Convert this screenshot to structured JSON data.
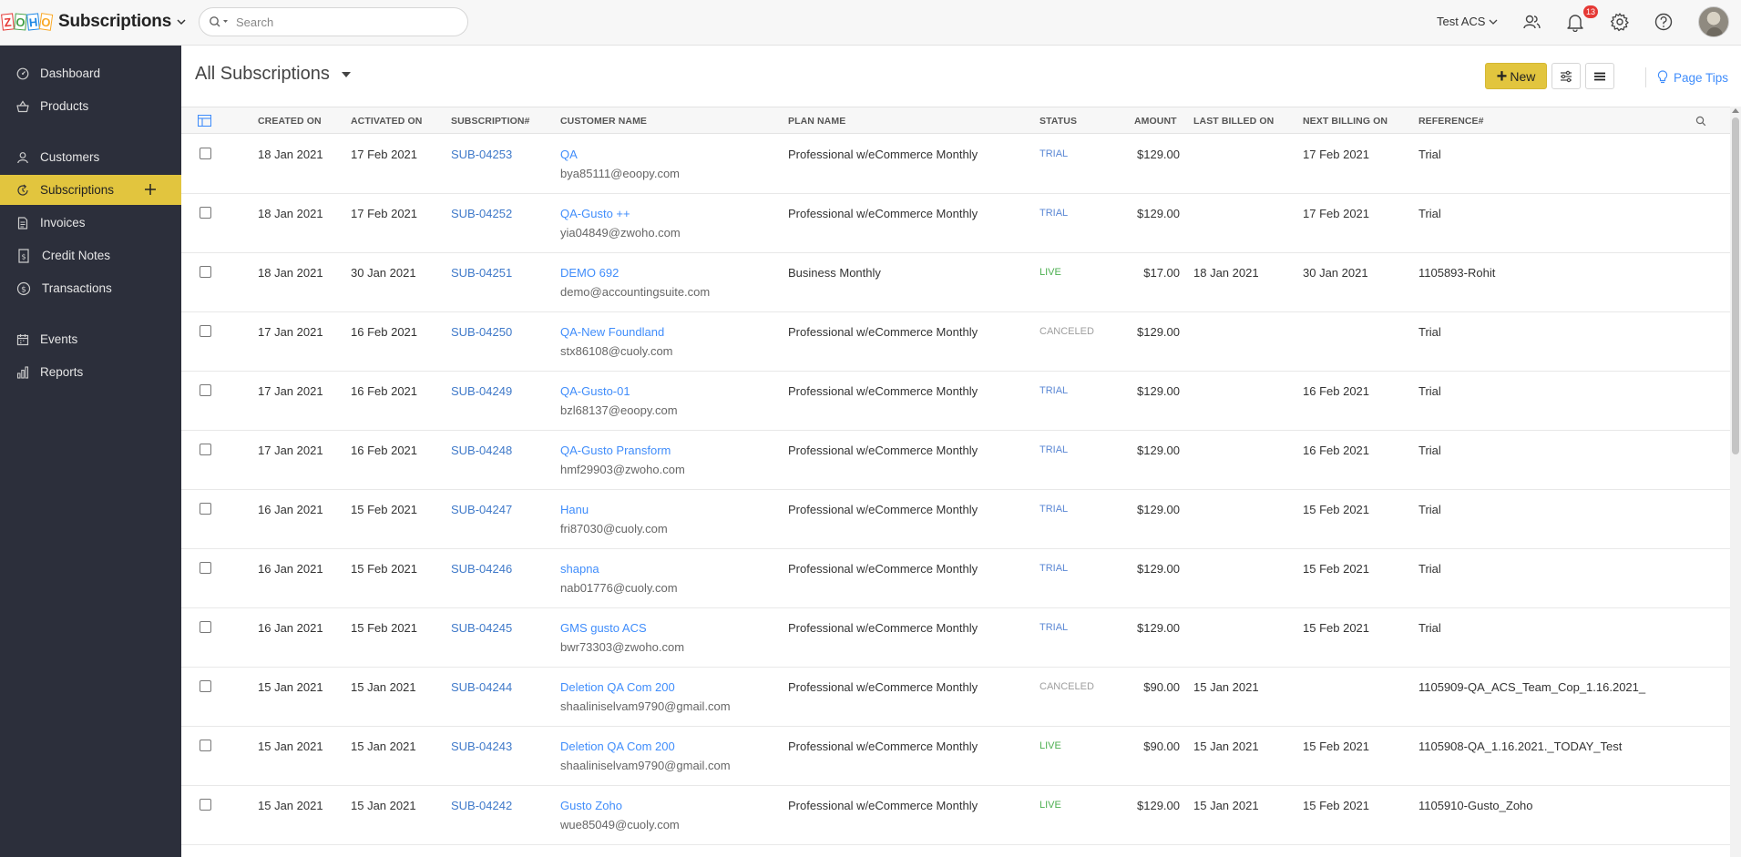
{
  "app": {
    "logo_letters": [
      "Z",
      "O",
      "H",
      "O"
    ],
    "name": "Subscriptions"
  },
  "search": {
    "placeholder": "Search"
  },
  "org": {
    "name": "Test ACS"
  },
  "notifications": {
    "count": "13"
  },
  "sidebar": {
    "items": [
      {
        "label": "Dashboard",
        "icon": "dashboard-icon"
      },
      {
        "label": "Products",
        "icon": "basket-icon"
      },
      {
        "label": "Customers",
        "icon": "user-icon"
      },
      {
        "label": "Subscriptions",
        "icon": "refresh-icon",
        "active": true
      },
      {
        "label": "Invoices",
        "icon": "document-icon"
      },
      {
        "label": "Credit Notes",
        "icon": "credit-note-icon"
      },
      {
        "label": "Transactions",
        "icon": "dollar-icon"
      },
      {
        "label": "Events",
        "icon": "calendar-icon"
      },
      {
        "label": "Reports",
        "icon": "bar-chart-icon"
      }
    ]
  },
  "page": {
    "title": "All Subscriptions",
    "new_label": "New",
    "page_tips_label": "Page Tips"
  },
  "table": {
    "columns": [
      "CREATED ON",
      "ACTIVATED ON",
      "SUBSCRIPTION#",
      "CUSTOMER NAME",
      "PLAN NAME",
      "STATUS",
      "AMOUNT",
      "LAST BILLED ON",
      "NEXT BILLING ON",
      "REFERENCE#"
    ],
    "rows": [
      {
        "created": "18 Jan 2021",
        "activated": "17 Feb 2021",
        "sub": "SUB-04253",
        "customer": "QA",
        "email": "bya85111@eoopy.com",
        "plan": "Professional w/eCommerce Monthly",
        "status": "TRIAL",
        "amount": "$129.00",
        "last": "",
        "next": "17 Feb 2021",
        "ref": "Trial"
      },
      {
        "created": "18 Jan 2021",
        "activated": "17 Feb 2021",
        "sub": "SUB-04252",
        "customer": "QA-Gusto ++",
        "email": "yia04849@zwoho.com",
        "plan": "Professional w/eCommerce Monthly",
        "status": "TRIAL",
        "amount": "$129.00",
        "last": "",
        "next": "17 Feb 2021",
        "ref": "Trial"
      },
      {
        "created": "18 Jan 2021",
        "activated": "30 Jan 2021",
        "sub": "SUB-04251",
        "customer": "DEMO 692",
        "email": "demo@accountingsuite.com",
        "plan": "Business Monthly",
        "status": "LIVE",
        "amount": "$17.00",
        "last": "18 Jan 2021",
        "next": "30 Jan 2021",
        "ref": "1105893-Rohit"
      },
      {
        "created": "17 Jan 2021",
        "activated": "16 Feb 2021",
        "sub": "SUB-04250",
        "customer": "QA-New Foundland",
        "email": "stx86108@cuoly.com",
        "plan": "Professional w/eCommerce Monthly",
        "status": "CANCELED",
        "amount": "$129.00",
        "last": "",
        "next": "",
        "ref": "Trial"
      },
      {
        "created": "17 Jan 2021",
        "activated": "16 Feb 2021",
        "sub": "SUB-04249",
        "customer": "QA-Gusto-01",
        "email": "bzl68137@eoopy.com",
        "plan": "Professional w/eCommerce Monthly",
        "status": "TRIAL",
        "amount": "$129.00",
        "last": "",
        "next": "16 Feb 2021",
        "ref": "Trial"
      },
      {
        "created": "17 Jan 2021",
        "activated": "16 Feb 2021",
        "sub": "SUB-04248",
        "customer": "QA-Gusto Pransform",
        "email": "hmf29903@zwoho.com",
        "plan": "Professional w/eCommerce Monthly",
        "status": "TRIAL",
        "amount": "$129.00",
        "last": "",
        "next": "16 Feb 2021",
        "ref": "Trial"
      },
      {
        "created": "16 Jan 2021",
        "activated": "15 Feb 2021",
        "sub": "SUB-04247",
        "customer": "Hanu",
        "email": "fri87030@cuoly.com",
        "plan": "Professional w/eCommerce Monthly",
        "status": "TRIAL",
        "amount": "$129.00",
        "last": "",
        "next": "15 Feb 2021",
        "ref": "Trial"
      },
      {
        "created": "16 Jan 2021",
        "activated": "15 Feb 2021",
        "sub": "SUB-04246",
        "customer": "shapna",
        "email": "nab01776@cuoly.com",
        "plan": "Professional w/eCommerce Monthly",
        "status": "TRIAL",
        "amount": "$129.00",
        "last": "",
        "next": "15 Feb 2021",
        "ref": "Trial"
      },
      {
        "created": "16 Jan 2021",
        "activated": "15 Feb 2021",
        "sub": "SUB-04245",
        "customer": "GMS gusto ACS",
        "email": "bwr73303@zwoho.com",
        "plan": "Professional w/eCommerce Monthly",
        "status": "TRIAL",
        "amount": "$129.00",
        "last": "",
        "next": "15 Feb 2021",
        "ref": "Trial"
      },
      {
        "created": "15 Jan 2021",
        "activated": "15 Jan 2021",
        "sub": "SUB-04244",
        "customer": "Deletion QA Com 200",
        "email": "shaaliniselvam9790@gmail.com",
        "plan": "Professional w/eCommerce Monthly",
        "status": "CANCELED",
        "amount": "$90.00",
        "last": "15 Jan 2021",
        "next": "",
        "ref": "1105909-QA_ACS_Team_Cop_1.16.2021_"
      },
      {
        "created": "15 Jan 2021",
        "activated": "15 Jan 2021",
        "sub": "SUB-04243",
        "customer": "Deletion QA Com 200",
        "email": "shaaliniselvam9790@gmail.com",
        "plan": "Professional w/eCommerce Monthly",
        "status": "LIVE",
        "amount": "$90.00",
        "last": "15 Jan 2021",
        "next": "15 Feb 2021",
        "ref": "1105908-QA_1.16.2021._TODAY_Test"
      },
      {
        "created": "15 Jan 2021",
        "activated": "15 Jan 2021",
        "sub": "SUB-04242",
        "customer": "Gusto Zoho",
        "email": "wue85049@cuoly.com",
        "plan": "Professional w/eCommerce Monthly",
        "status": "LIVE",
        "amount": "$129.00",
        "last": "15 Jan 2021",
        "next": "15 Feb 2021",
        "ref": "1105910-Gusto_Zoho"
      }
    ]
  },
  "colors": {
    "accent": "#e2c53e",
    "sidebar_bg": "#2c2f3b",
    "link": "#408dfb",
    "trial": "#5a87d4",
    "live": "#4caf50",
    "canceled": "#9e9e9e"
  }
}
